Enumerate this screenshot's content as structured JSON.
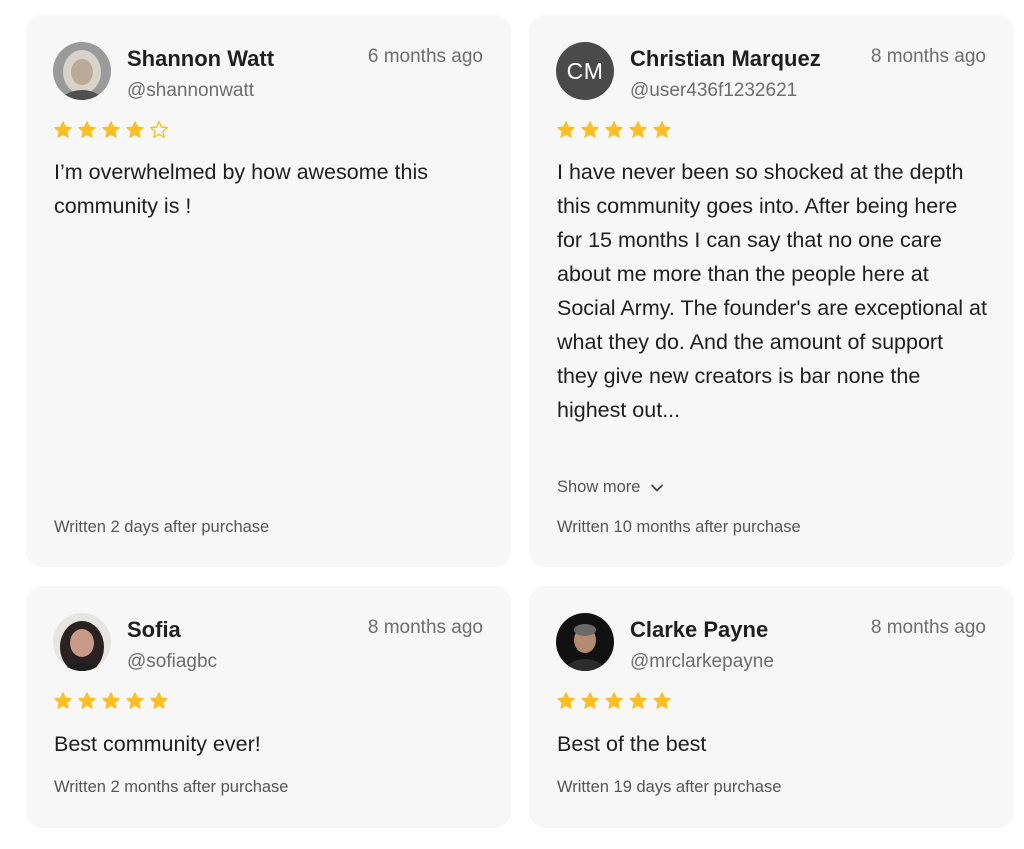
{
  "colors": {
    "card_bg": "#f7f7f7",
    "star_fill": "#fbbf24",
    "avatar_initials_bg": "#4a4a4a"
  },
  "reviews": [
    {
      "name": "Shannon Watt",
      "handle": "@shannonwatt",
      "date": "6 months ago",
      "rating": 4,
      "text": "I’m overwhelmed by how awesome this community is !",
      "footer": "Written 2 days after purchase",
      "avatar": "photo"
    },
    {
      "name": "Christian Marquez",
      "handle": "@user436f1232621",
      "date": "8 months ago",
      "rating": 5,
      "initials": "CM",
      "text": "I have never been so shocked at the depth this community goes into. After being here for 15 months I can say that no one care about me more than the people here at Social Army. The founder's are exceptional at what they do. And the amount of support they give new creators is bar none the highest out...",
      "show_more": "Show more",
      "footer": "Written 10 months after purchase",
      "avatar": "initials"
    },
    {
      "name": "Sofia",
      "handle": "@sofiagbc",
      "date": "8 months ago",
      "rating": 5,
      "text": "Best community ever!",
      "footer": "Written 2 months after purchase",
      "avatar": "photo"
    },
    {
      "name": "Clarke Payne",
      "handle": "@mrclarkepayne",
      "date": "8 months ago",
      "rating": 5,
      "text": "Best of the best",
      "footer": "Written 19 days after purchase",
      "avatar": "photo"
    }
  ]
}
